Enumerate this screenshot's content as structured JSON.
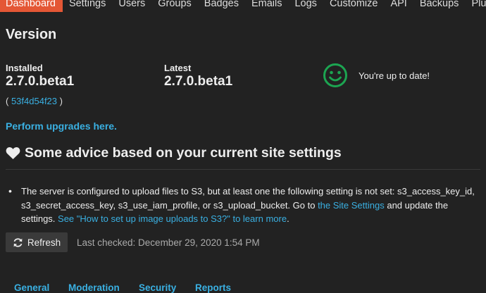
{
  "nav": {
    "items": [
      "Dashboard",
      "Settings",
      "Users",
      "Groups",
      "Badges",
      "Emails",
      "Logs",
      "Customize",
      "API",
      "Backups",
      "Plugins"
    ]
  },
  "version": {
    "title": "Version",
    "installed_label": "Installed",
    "installed_value": "2.7.0.beta1",
    "latest_label": "Latest",
    "latest_value": "2.7.0.beta1",
    "hash_open": "( ",
    "hash": "53f4d54f23",
    "hash_close": " )",
    "status_text": "You're up to date!",
    "upgrade_link": "Perform upgrades here."
  },
  "advice": {
    "title": "Some advice based on your current site settings",
    "item_text": "The server is configured to upload files to S3, but at least one the following setting is not set: s3_access_key_id, s3_secret_access_key, s3_use_iam_profile, or s3_upload_bucket. Go to ",
    "site_settings_link": "the Site Settings",
    "update_text": " and update the settings. ",
    "howto_link": "See \"How to set up image uploads to S3?\" to learn more",
    "period": "."
  },
  "refresh": {
    "label": "Refresh",
    "last_checked": "Last checked: December 29, 2020 1:54 PM"
  },
  "bottom_tabs": [
    "General",
    "Moderation",
    "Security",
    "Reports"
  ],
  "colors": {
    "accent": "#e45735",
    "link": "#3ab0e2",
    "success": "#1ca551",
    "background": "#222222"
  },
  "icons": {
    "status": "smile-icon",
    "advice": "heart-icon",
    "refresh": "refresh-icon"
  }
}
